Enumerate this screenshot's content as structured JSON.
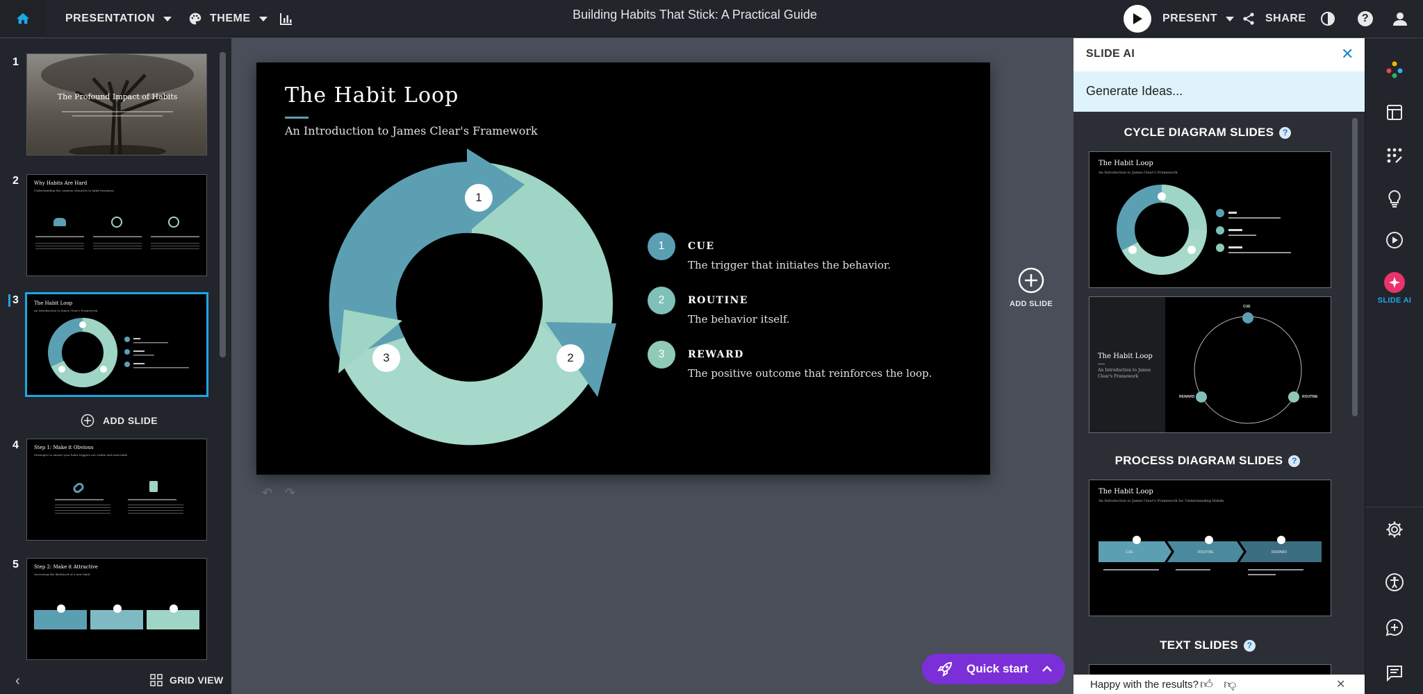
{
  "topbar": {
    "presentation_menu": "PRESENTATION",
    "theme_menu": "THEME",
    "doc_title": "Building Habits That Stick: A Practical Guide",
    "present_label": "PRESENT",
    "share_label": "SHARE"
  },
  "slides_panel": {
    "thumbnails": [
      {
        "number": "1",
        "title": "The Profound Impact of Habits"
      },
      {
        "number": "2",
        "title": "Why Habits Are Hard",
        "subtitle": "Understanding the common obstacles to habit formation"
      },
      {
        "number": "3",
        "title": "The Habit Loop",
        "subtitle": "An Introduction to James Clear's Framework"
      },
      {
        "number": "4",
        "title": "Step 1: Make it Obvious",
        "subtitle": "Strategies to ensure your habit triggers are visible and noticeable"
      },
      {
        "number": "5",
        "title": "Step 2: Make it Attractive",
        "subtitle": "Increasing the likelihood of a new habit"
      }
    ],
    "add_slide_label": "ADD SLIDE",
    "grid_view_label": "GRID VIEW"
  },
  "slide": {
    "title": "The Habit Loop",
    "subtitle": "An Introduction to James Clear's Framework",
    "cycle_markers": [
      "1",
      "2",
      "3"
    ],
    "steps": [
      {
        "number": "1",
        "label": "CUE",
        "desc": "The trigger that initiates the behavior."
      },
      {
        "number": "2",
        "label": "ROUTINE",
        "desc": "The behavior itself."
      },
      {
        "number": "3",
        "label": "REWARD",
        "desc": "The positive outcome that reinforces the loop."
      }
    ],
    "add_slide_label": "ADD SLIDE"
  },
  "ai_panel": {
    "header": "SLIDE AI",
    "generate": "Generate Ideas...",
    "sections": {
      "cycle": "CYCLE DIAGRAM SLIDES",
      "process": "PROCESS DIAGRAM SLIDES",
      "text": "TEXT SLIDES"
    },
    "cards": {
      "cycle1": {
        "title": "The Habit Loop",
        "subtitle": "An Introduction to James Clear's Framework"
      },
      "cycle2": {
        "title": "The Habit Loop",
        "subtitle": "An Introduction to James Clear's Framework",
        "labels": [
          "CUE",
          "ROUTINE",
          "REWARD"
        ]
      },
      "process1": {
        "title": "The Habit Loop",
        "subtitle": "An Introduction to James Clear's Framework for Understanding Habits",
        "labels": [
          "CUE",
          "ROUTINE",
          "REWARD"
        ]
      }
    },
    "feedback": "Happy with the results?"
  },
  "rail": {
    "slide_ai_label": "SLIDE AI"
  },
  "quickstart_label": "Quick start",
  "colors": {
    "teal_dark": "#5b9fb2",
    "teal_light": "#9ed5c4",
    "accent": "#1ea7e6",
    "quickstart": "#7b2fd9"
  }
}
